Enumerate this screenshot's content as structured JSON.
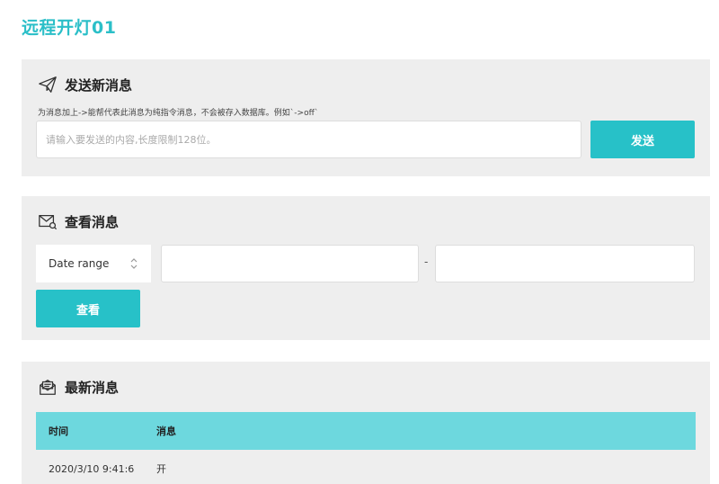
{
  "page": {
    "title": "远程开灯01"
  },
  "send_section": {
    "title": "发送新消息",
    "hint": "为消息加上->能帮代表此消息为纯指令消息，不会被存入数据库。例如`->off`",
    "input_placeholder": "请输入要发送的内容,长度限制128位。",
    "send_button": "发送"
  },
  "view_section": {
    "title": "查看消息",
    "range_select": "Date range",
    "range_separator": "-",
    "view_button": "查看"
  },
  "latest_section": {
    "title": "最新消息",
    "columns": {
      "time": "时间",
      "message": "消息"
    },
    "rows": [
      {
        "time": "2020/3/10 9:41:6",
        "message": "开"
      }
    ]
  },
  "colors": {
    "accent": "#27c1c8",
    "table_header": "#6dd8de",
    "card_bg": "#eeeeee"
  },
  "icons": {
    "send": "paper-plane-icon",
    "view": "envelope-search-icon",
    "latest": "envelope-open-icon",
    "select": "updown-icon"
  }
}
